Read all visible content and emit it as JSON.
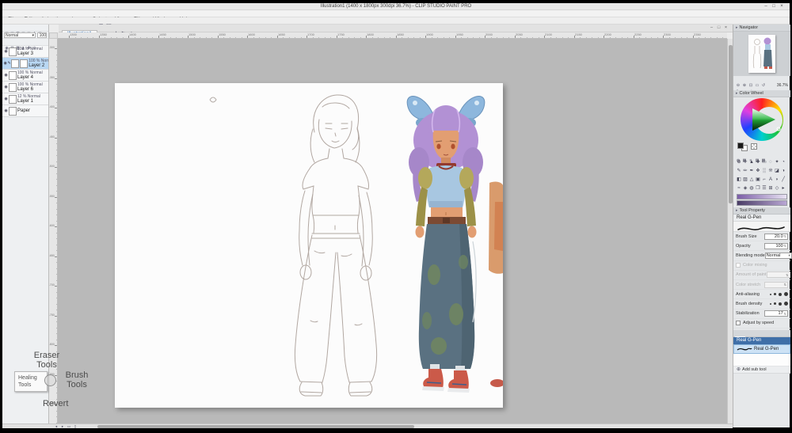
{
  "window": {
    "title": "Illustration1 (1400 x 1800px 300dpi 36.7%) - CLIP STUDIO PAINT PRO",
    "controls": [
      "–",
      "□",
      "×"
    ],
    "doc_controls": [
      "–",
      "□",
      "×"
    ]
  },
  "menu": {
    "items": [
      "File",
      "Edit",
      "Animation",
      "Layer",
      "Select",
      "View",
      "Filter",
      "Window",
      "Help"
    ]
  },
  "toolbar": {
    "icons": [
      {
        "name": "new-file-icon",
        "glyph": "▤"
      },
      {
        "name": "save-icon",
        "glyph": "▥"
      },
      {
        "name": "undo-icon",
        "glyph": "↶"
      },
      {
        "name": "redo-icon",
        "glyph": "↷"
      },
      {
        "name": "cut-icon",
        "glyph": "✂"
      },
      {
        "name": "copy-icon",
        "glyph": "❐"
      },
      {
        "name": "delete-icon",
        "glyph": "⌫"
      },
      {
        "name": "fill-icon",
        "glyph": "◧"
      },
      {
        "name": "grid-icon",
        "glyph": "⊞"
      },
      {
        "name": "snap-icon",
        "glyph": "⌗"
      }
    ]
  },
  "document_tab": {
    "label": "Illustration1"
  },
  "tab_row": {
    "icons": [
      {
        "name": "select-mode-icon",
        "glyph": "▭"
      },
      {
        "name": "hand-icon",
        "glyph": "✛"
      },
      {
        "name": "rotate-view-icon",
        "glyph": "↻"
      },
      {
        "name": "flip-view-icon",
        "glyph": "⇄"
      }
    ]
  },
  "rulers": {
    "h": [
      "1300",
      "1350",
      "1400",
      "1450",
      "1500",
      "1550",
      "1600",
      "1650",
      "1700",
      "1750",
      "1800",
      "1850",
      "1900",
      "1950",
      "2000",
      "2050",
      "2100",
      "2150",
      "2200",
      "2250",
      "2300",
      "2350"
    ],
    "v": [
      "1300",
      "1350",
      "1400",
      "1450",
      "1500",
      "1550",
      "1600",
      "1650",
      "1700",
      "1750",
      "1800",
      "1850",
      "1900"
    ]
  },
  "layers_panel": {
    "header_icons1": [
      "◫",
      "▤",
      "☰",
      "◨",
      "▧",
      "✚",
      "▣"
    ],
    "header_icons2": [
      "◉",
      "⊠",
      "▩",
      "◭",
      "✚",
      "⊖"
    ],
    "blend_label": "Normal",
    "opacity_value": "100",
    "items": [
      {
        "visible": true,
        "opacity": "100",
        "mode": "Normal",
        "name": "Layer 3",
        "selected": false,
        "thumbs": 1
      },
      {
        "visible": true,
        "opacity": "100",
        "mode": "Normal",
        "name": "Layer 2",
        "selected": true,
        "thumbs": 2
      },
      {
        "visible": true,
        "opacity": "100",
        "mode": "Normal",
        "name": "Layer 4",
        "selected": false,
        "thumbs": 1
      },
      {
        "visible": true,
        "opacity": "100",
        "mode": "Normal",
        "name": "Layer 6",
        "selected": false,
        "thumbs": 1
      },
      {
        "visible": true,
        "opacity": "12",
        "mode": "Normal",
        "name": "Layer 1",
        "selected": false,
        "thumbs": 1
      },
      {
        "visible": true,
        "opacity": "",
        "mode": "",
        "name": "Paper",
        "selected": false,
        "thumbs": 1,
        "paper": true
      }
    ]
  },
  "navigator": {
    "title": "Navigator",
    "zoom_value": "36.7%",
    "icons_row1": [
      {
        "name": "zoom-out-icon",
        "glyph": "⊖"
      },
      {
        "name": "zoom-in-icon",
        "glyph": "⊕"
      },
      {
        "name": "fit-to-screen-icon",
        "glyph": "⊡"
      },
      {
        "name": "actual-size-icon",
        "glyph": "▭"
      },
      {
        "name": "reset-view-icon",
        "glyph": "↺"
      }
    ],
    "icons_row2": [
      {
        "name": "rotate-right-icon",
        "glyph": "↻"
      },
      {
        "name": "rotate-reset-icon",
        "glyph": "↩"
      },
      {
        "name": "flip-horizontal-icon",
        "glyph": "⇄"
      }
    ]
  },
  "color_wheel": {
    "title": "Color Wheel"
  },
  "palette_row": [
    {
      "name": "color-wheel-tab-icon",
      "glyph": "◍"
    },
    {
      "name": "color-set-tab-icon",
      "glyph": "▦"
    },
    {
      "name": "color-slider-tab-icon",
      "glyph": "≡"
    },
    {
      "name": "intermediate-color-tab-icon",
      "glyph": "▨"
    },
    {
      "name": "approximate-color-tab-icon",
      "glyph": "▩"
    }
  ],
  "tools": [
    {
      "name": "zoom-tool-icon",
      "glyph": "⊕"
    },
    {
      "name": "move-tool-icon",
      "glyph": "✛"
    },
    {
      "name": "operation-tool-icon",
      "glyph": "▲"
    },
    {
      "name": "layer-move-tool-icon",
      "glyph": "✚"
    },
    {
      "name": "selection-tool-icon",
      "glyph": "▭"
    },
    {
      "name": "lasso-tool-icon",
      "glyph": "◌"
    },
    {
      "name": "auto-select-tool-icon",
      "glyph": "✦"
    },
    {
      "name": "eyedropper-tool-icon",
      "glyph": "◔"
    },
    {
      "name": "pen-tool-icon",
      "glyph": "✎"
    },
    {
      "name": "pencil-tool-icon",
      "glyph": "✏"
    },
    {
      "name": "brush-tool-icon",
      "glyph": "✒"
    },
    {
      "name": "watercolor-tool-icon",
      "glyph": "❖"
    },
    {
      "name": "airbrush-tool-icon",
      "glyph": "░"
    },
    {
      "name": "decoration-tool-icon",
      "glyph": "❊"
    },
    {
      "name": "eraser-tool-icon",
      "glyph": "◪"
    },
    {
      "name": "blend-tool-icon",
      "glyph": "◑"
    },
    {
      "name": "fill-tool-icon",
      "glyph": "◧"
    },
    {
      "name": "gradient-tool-icon",
      "glyph": "▨"
    },
    {
      "name": "figure-tool-icon",
      "glyph": "△"
    },
    {
      "name": "frame-tool-icon",
      "glyph": "▣"
    },
    {
      "name": "ruler-tool-icon",
      "glyph": "⌐"
    },
    {
      "name": "text-tool-icon",
      "glyph": "A"
    },
    {
      "name": "balloon-tool-icon",
      "glyph": "◗"
    },
    {
      "name": "correction-tool-icon",
      "glyph": "╱"
    },
    {
      "name": "liquify-tool-icon",
      "glyph": "≈"
    },
    {
      "name": "selection-launcher-icon",
      "glyph": "◈"
    },
    {
      "name": "mask-tool-icon",
      "glyph": "◍"
    },
    {
      "name": "material-tool-icon",
      "glyph": "❒"
    },
    {
      "name": "story-tool-icon",
      "glyph": "☰"
    },
    {
      "name": "grid-tool-icon",
      "glyph": "⊞"
    },
    {
      "name": "symmetry-tool-icon",
      "glyph": "◇"
    },
    {
      "name": "timeline-tool-icon",
      "glyph": "▸"
    }
  ],
  "gradients": [
    "#7b5ea7",
    "#b9a6d4"
  ],
  "tool_property": {
    "title": "Tool Property",
    "tool_name": "Real G-Pen",
    "rows": [
      {
        "label": "Brush Size",
        "value": "20.0",
        "type": "slider"
      },
      {
        "label": "Opacity",
        "value": "100",
        "type": "slider"
      },
      {
        "label": "Blending mode",
        "value": "Normal",
        "type": "dropdown"
      },
      {
        "label": "Color mixing",
        "value": "",
        "type": "check-disabled"
      },
      {
        "label": "Amount of paint",
        "value": "",
        "type": "slider-disabled"
      },
      {
        "label": "Color stretch",
        "value": "",
        "type": "slider-disabled"
      },
      {
        "label": "Anti-aliasing",
        "value": "",
        "type": "aa"
      },
      {
        "label": "Brush density",
        "value": "",
        "type": "dots"
      },
      {
        "label": "Stabilization",
        "value": "17",
        "type": "slider"
      },
      {
        "label": "Adjust by speed",
        "value": "",
        "type": "check"
      }
    ]
  },
  "sub_tool": {
    "tabs": [
      {
        "name": "subtool-tab-pen",
        "glyph": "✎"
      },
      {
        "name": "subtool-tab-marker",
        "glyph": "✒"
      }
    ],
    "group_label": "Real G-Pen",
    "items": [
      {
        "name": "Real G-Pen",
        "selected": true
      }
    ],
    "footer": "Add sub tool"
  },
  "bottom_bar": {
    "icons": [
      {
        "name": "scroll-left-icon",
        "glyph": "◂"
      },
      {
        "name": "scroll-right-icon",
        "glyph": "▸"
      },
      {
        "name": "fit-width-icon",
        "glyph": "▭"
      },
      {
        "name": "page-icon",
        "glyph": "▯"
      }
    ]
  },
  "overlays": {
    "eraser": "Eraser\nTools",
    "healing": "Healing\nTools",
    "brush": "Brush\nTools",
    "revert": "Revert"
  },
  "colors": {
    "accent_blue": "#3e7fc1",
    "selection_blue": "#b9d7f3",
    "subtool_group_blue": "#3f6fa8",
    "canvas_surround": "#b9b9b9",
    "panel_gray": "#e6e8ea",
    "hair_purple": "#b291d4",
    "top_blue": "#a8c7e1",
    "skirt_teal": "#5a7181",
    "shoe_red": "#cb5a49",
    "wheel_green": "#23b43a"
  }
}
